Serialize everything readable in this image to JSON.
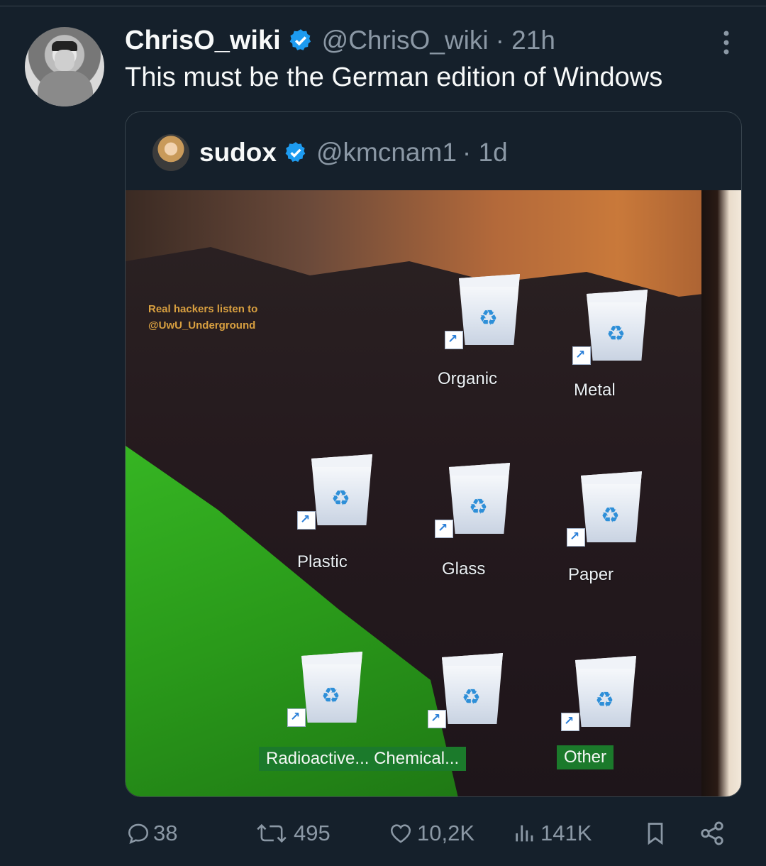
{
  "tweet": {
    "author_name": "ChrisO_wiki",
    "author_handle": "@ChrisO_wiki",
    "time": "· 21h",
    "text": "This must be the German edition of Windows"
  },
  "quoted": {
    "author_name": "sudox",
    "author_handle": "@kmcnam1",
    "time": "· 1d",
    "image": {
      "watermark_line1": "Real hackers listen to",
      "watermark_line2": "@UwU_Underground",
      "icons": [
        "Organic",
        "Metal",
        "Plastic",
        "Glass",
        "Paper",
        "Radioactive...",
        "Chemical...",
        "Other"
      ]
    }
  },
  "actions": {
    "replies": "38",
    "retweets": "495",
    "likes": "10,2K",
    "views": "141K"
  },
  "colors": {
    "background": "#15202b",
    "verified": "#1d9bf0",
    "secondary_text": "#8b98a5",
    "selection_green": "#1b7a2b"
  },
  "icons": {
    "verified": "verified-badge-icon",
    "more": "more-options-icon",
    "reply": "reply-icon",
    "retweet": "retweet-icon",
    "like": "heart-icon",
    "views": "views-icon",
    "bookmark": "bookmark-icon",
    "share": "share-icon",
    "recycle_bin": "recycle-bin-icon"
  }
}
